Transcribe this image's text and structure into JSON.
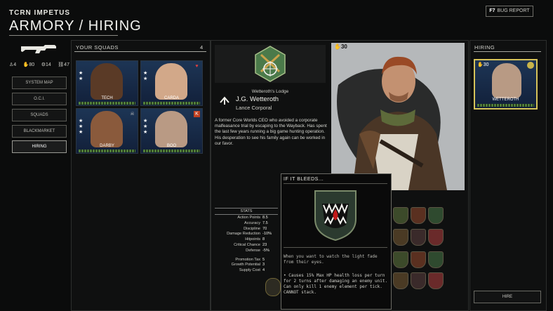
{
  "header": {
    "org": "TCRN IMPETUS",
    "title": "ARMORY / HIRING",
    "bug_key": "F7",
    "bug_label": "BUG REPORT"
  },
  "resources": [
    {
      "icon": "soldier-icon",
      "value": "4"
    },
    {
      "icon": "fist-icon",
      "value": "80"
    },
    {
      "icon": "gear-icon",
      "value": "14"
    },
    {
      "icon": "credits-icon",
      "value": "47"
    }
  ],
  "nav": [
    "SYSTEM MAP",
    "O.C.I.",
    "SQUADS",
    "BLACKMARKET",
    "HIRING"
  ],
  "nav_active": "HIRING",
  "squads": {
    "title": "YOUR SQUADS",
    "count": "4",
    "members": [
      {
        "name": "TECH",
        "stars": 2,
        "skin": "#5a3a26",
        "tag_icon": "none-icon"
      },
      {
        "name": "CARDA",
        "stars": 2,
        "skin": "#d2a889",
        "tag_icon": "heart-icon"
      },
      {
        "name": "DARBY",
        "stars": 3,
        "skin": "#8a5a3c",
        "tag_icon": "skull-icon"
      },
      {
        "name": "BOO",
        "stars": 3,
        "skin": "#b99a84",
        "tag_icon": "k-badge-icon"
      }
    ]
  },
  "character": {
    "lodge": "Wetteroth's Lodge",
    "name": "J.G. Wetteroth",
    "rank": "Lance Corporal",
    "cost": "30",
    "bio": "A former Core Worlds CEO who avoided a corporate malfeasance trial by escaping to the Wayback. Has spent the last few years running a big game hunting operation. His desperation to see his family again can be worked in our favor."
  },
  "stats": {
    "header": "STATS",
    "rows": [
      {
        "k": "Action Points",
        "v": "8.5"
      },
      {
        "k": "Accuracy",
        "v": "7.5"
      },
      {
        "k": "Discipline",
        "v": "70"
      },
      {
        "k": "Damage Reduction",
        "v": "-10%"
      },
      {
        "k": "Hitpoints",
        "v": "8"
      },
      {
        "k": "Critical Chance",
        "v": "23"
      },
      {
        "k": "Defense",
        "v": "-5%"
      }
    ],
    "rows2": [
      {
        "k": "Promotion Tax",
        "v": "5"
      },
      {
        "k": "Growth Potential",
        "v": "3"
      },
      {
        "k": "Supply Cost",
        "v": "4"
      }
    ]
  },
  "tooltip": {
    "title": "IF IT BLEEDS...",
    "flavor": "When you want to watch the light fade from their eyes.",
    "effect": "• Causes 15% Max HP health loss per turn for 2 turns after damaging an enemy unit. Can only kill 1 enemy element per tick. CANNOT stack."
  },
  "hiring": {
    "title": "HIRING",
    "candidate_name": "WETTEROTH",
    "candidate_cost": "30",
    "hire_label": "HIRE"
  }
}
